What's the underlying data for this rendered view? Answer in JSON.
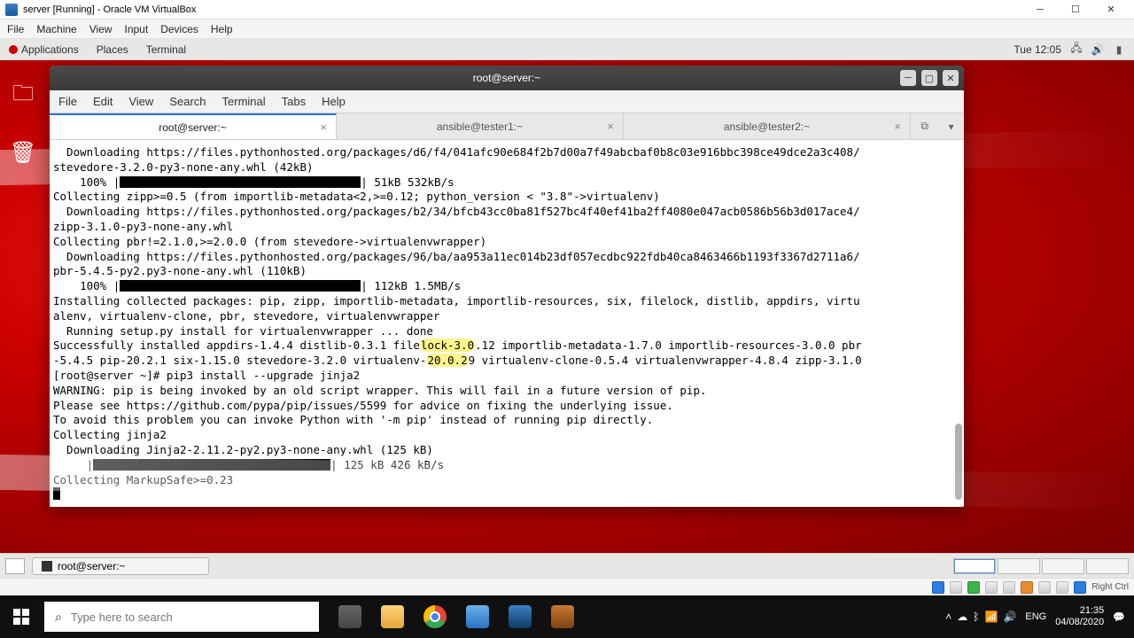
{
  "vbox": {
    "title": "server [Running] - Oracle VM VirtualBox",
    "menu": [
      "File",
      "Machine",
      "View",
      "Input",
      "Devices",
      "Help"
    ],
    "status_right": "Right Ctrl"
  },
  "gnome": {
    "panel_left": [
      "Applications",
      "Places",
      "Terminal"
    ],
    "clock": "Tue 12:05",
    "taskbar_item": "root@server:~"
  },
  "terminal": {
    "title": "root@server:~",
    "menu": [
      "File",
      "Edit",
      "View",
      "Search",
      "Terminal",
      "Tabs",
      "Help"
    ],
    "tabs": [
      {
        "label": "root@server:~",
        "active": true
      },
      {
        "label": "ansible@tester1:~",
        "active": false
      },
      {
        "label": "ansible@tester2:~",
        "active": false
      }
    ],
    "lines": {
      "l1": "  Downloading https://files.pythonhosted.org/packages/d6/f4/041afc90e684f2b7d00a7f49abcbaf0b8c03e916bbc398ce49dce2a3c408/",
      "l2": "stevedore-3.2.0-py3-none-any.whl (42kB)",
      "l3a": "    100% |",
      "l3b": "| 51kB 532kB/s ",
      "l4": "Collecting zipp>=0.5 (from importlib-metadata<2,>=0.12; python_version < \"3.8\"->virtualenv)",
      "l5": "  Downloading https://files.pythonhosted.org/packages/b2/34/bfcb43cc0ba81f527bc4f40ef41ba2ff4080e047acb0586b56b3d017ace4/",
      "l6": "zipp-3.1.0-py3-none-any.whl",
      "l7": "Collecting pbr!=2.1.0,>=2.0.0 (from stevedore->virtualenvwrapper)",
      "l8": "  Downloading https://files.pythonhosted.org/packages/96/ba/aa953a11ec014b23df057ecdbc922fdb40ca8463466b1193f3367d2711a6/",
      "l9": "pbr-5.4.5-py2.py3-none-any.whl (110kB)",
      "l10a": "    100% |",
      "l10b": "| 112kB 1.5MB/s ",
      "l11": "Installing collected packages: pip, zipp, importlib-metadata, importlib-resources, six, filelock, distlib, appdirs, virtu",
      "l12": "alenv, virtualenv-clone, pbr, stevedore, virtualenvwrapper",
      "l13": "  Running setup.py install for virtualenvwrapper ... done",
      "l14a": "Successfully installed appdirs-1.4.4 distlib-0.3.1 file",
      "l14h": "lock-3.0",
      "l14b": ".12 importlib-metadata-1.7.0 importlib-resources-3.0.0 pbr",
      "l15a": "-5.4.5 pip-20.2.1 six-1.15.0 stevedore-3.2.0 virtualenv-",
      "l15h": "20.0.2",
      "l15b": "9 virtualenv-clone-0.5.4 virtualenvwrapper-4.8.4 zipp-3.1.0",
      "l16": "[root@server ~]# pip3 install --upgrade jinja2",
      "l17": "WARNING: pip is being invoked by an old script wrapper. This will fail in a future version of pip.",
      "l18": "Please see https://github.com/pypa/pip/issues/5599 for advice on fixing the underlying issue.",
      "l19": "To avoid this problem you can invoke Python with '-m pip' instead of running pip directly.",
      "l20": "Collecting jinja2",
      "l21": "  Downloading Jinja2-2.11.2-py2.py3-none-any.whl (125 kB)",
      "l22a": "     |",
      "l22b": "| 125 kB 426 kB/s ",
      "l23": "Collecting MarkupSafe>=0.23"
    }
  },
  "windows": {
    "search_placeholder": "Type here to search",
    "lang": "ENG",
    "time": "21:35",
    "date": "04/08/2020"
  }
}
